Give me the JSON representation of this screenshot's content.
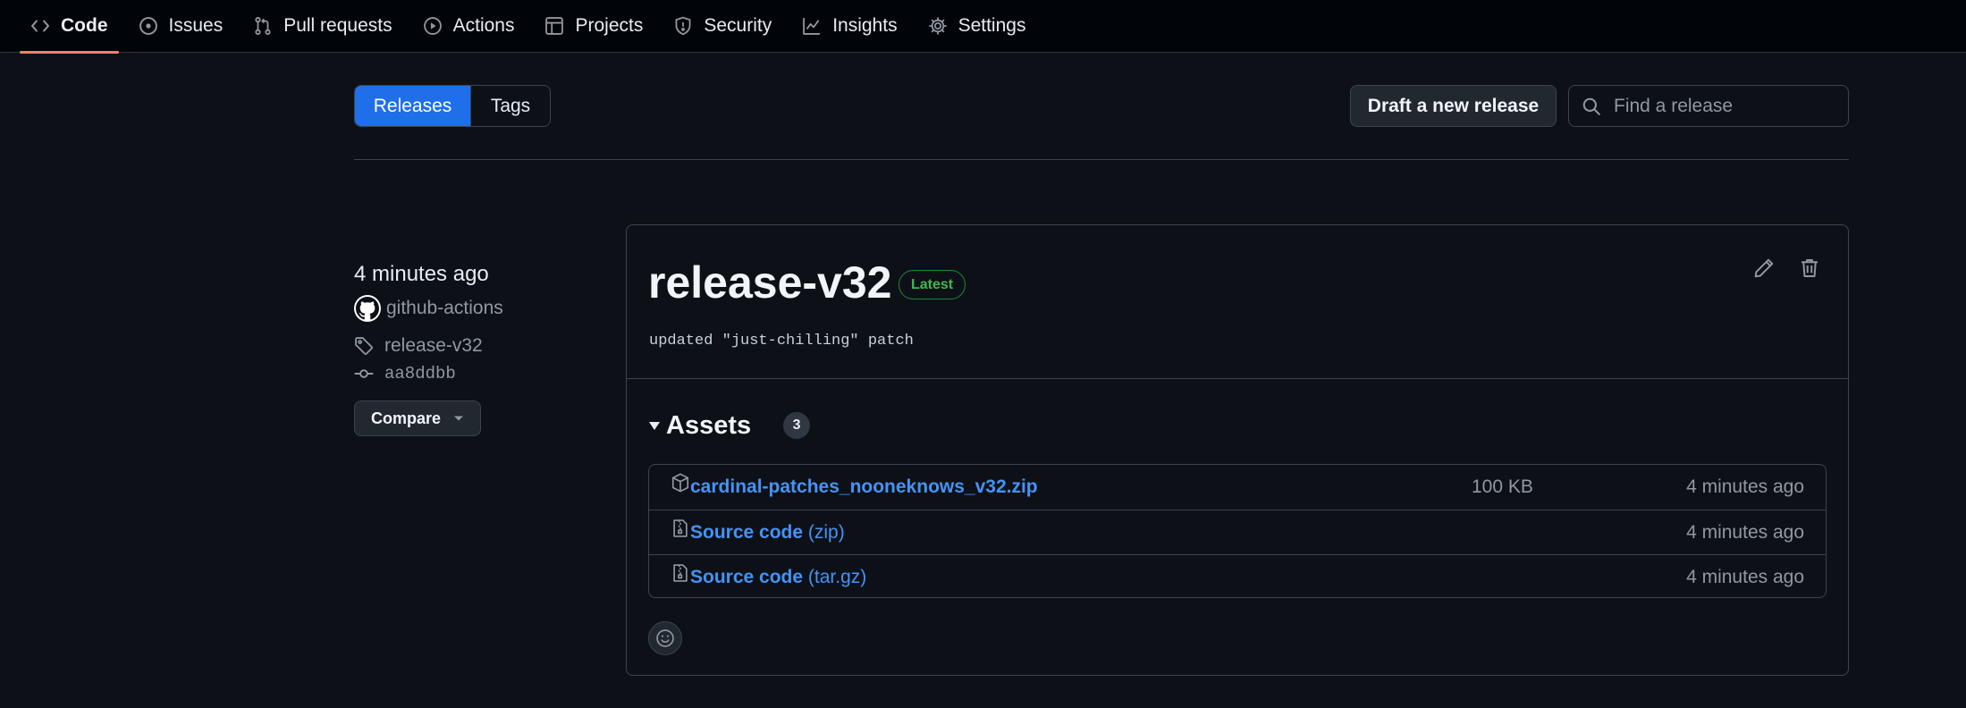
{
  "nav": {
    "items": [
      {
        "label": "Code",
        "icon": "code-icon",
        "selected": true
      },
      {
        "label": "Issues",
        "icon": "issue-icon"
      },
      {
        "label": "Pull requests",
        "icon": "pull-request-icon"
      },
      {
        "label": "Actions",
        "icon": "play-icon"
      },
      {
        "label": "Projects",
        "icon": "table-icon"
      },
      {
        "label": "Security",
        "icon": "shield-icon"
      },
      {
        "label": "Insights",
        "icon": "graph-icon"
      },
      {
        "label": "Settings",
        "icon": "gear-icon"
      }
    ],
    "accent_color": "#f78166"
  },
  "subnav": {
    "releases_label": "Releases",
    "tags_label": "Tags",
    "draft_label": "Draft a new release",
    "search_placeholder": "Find a release",
    "search_value": ""
  },
  "release": {
    "time": "4 minutes ago",
    "author": "github-actions",
    "tag": "release-v32",
    "commit": "aa8ddbb",
    "compare_label": "Compare",
    "title": "release-v32",
    "badge": "Latest",
    "body": "updated \"just-chilling\" patch",
    "assets_label": "Assets",
    "assets_count": "3",
    "assets": [
      {
        "name": "cardinal-patches_nooneknows_v32.zip",
        "suffix": "",
        "size": "100 KB",
        "time": "4 minutes ago",
        "icon": "package-icon"
      },
      {
        "name": "Source code",
        "suffix": "(zip)",
        "size": "",
        "time": "4 minutes ago",
        "icon": "file-zip-icon"
      },
      {
        "name": "Source code",
        "suffix": "(tar.gz)",
        "size": "",
        "time": "4 minutes ago",
        "icon": "file-zip-icon"
      }
    ]
  },
  "colors": {
    "background": "#0d1117",
    "primary_button": "#1f6feb",
    "link": "#4493f8",
    "latest_badge": "#3fb950"
  }
}
